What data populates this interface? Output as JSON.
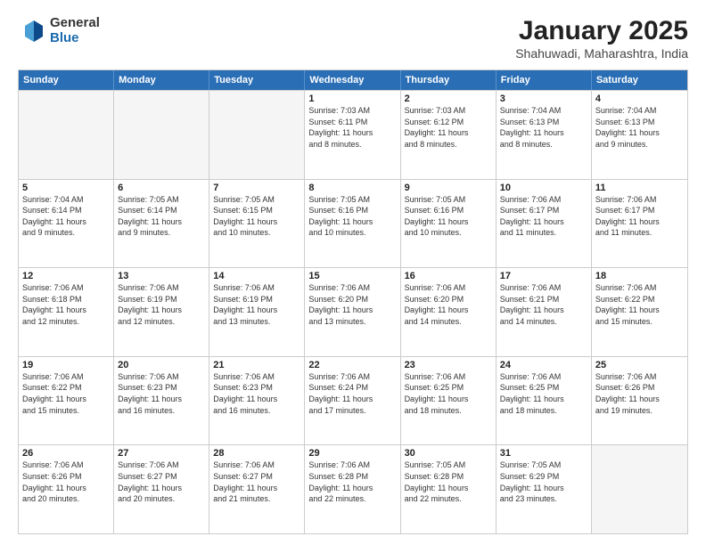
{
  "header": {
    "logo_general": "General",
    "logo_blue": "Blue",
    "title": "January 2025",
    "location": "Shahuwadi, Maharashtra, India"
  },
  "weekdays": [
    "Sunday",
    "Monday",
    "Tuesday",
    "Wednesday",
    "Thursday",
    "Friday",
    "Saturday"
  ],
  "rows": [
    [
      {
        "day": "",
        "info": ""
      },
      {
        "day": "",
        "info": ""
      },
      {
        "day": "",
        "info": ""
      },
      {
        "day": "1",
        "info": "Sunrise: 7:03 AM\nSunset: 6:11 PM\nDaylight: 11 hours\nand 8 minutes."
      },
      {
        "day": "2",
        "info": "Sunrise: 7:03 AM\nSunset: 6:12 PM\nDaylight: 11 hours\nand 8 minutes."
      },
      {
        "day": "3",
        "info": "Sunrise: 7:04 AM\nSunset: 6:13 PM\nDaylight: 11 hours\nand 8 minutes."
      },
      {
        "day": "4",
        "info": "Sunrise: 7:04 AM\nSunset: 6:13 PM\nDaylight: 11 hours\nand 9 minutes."
      }
    ],
    [
      {
        "day": "5",
        "info": "Sunrise: 7:04 AM\nSunset: 6:14 PM\nDaylight: 11 hours\nand 9 minutes."
      },
      {
        "day": "6",
        "info": "Sunrise: 7:05 AM\nSunset: 6:14 PM\nDaylight: 11 hours\nand 9 minutes."
      },
      {
        "day": "7",
        "info": "Sunrise: 7:05 AM\nSunset: 6:15 PM\nDaylight: 11 hours\nand 10 minutes."
      },
      {
        "day": "8",
        "info": "Sunrise: 7:05 AM\nSunset: 6:16 PM\nDaylight: 11 hours\nand 10 minutes."
      },
      {
        "day": "9",
        "info": "Sunrise: 7:05 AM\nSunset: 6:16 PM\nDaylight: 11 hours\nand 10 minutes."
      },
      {
        "day": "10",
        "info": "Sunrise: 7:06 AM\nSunset: 6:17 PM\nDaylight: 11 hours\nand 11 minutes."
      },
      {
        "day": "11",
        "info": "Sunrise: 7:06 AM\nSunset: 6:17 PM\nDaylight: 11 hours\nand 11 minutes."
      }
    ],
    [
      {
        "day": "12",
        "info": "Sunrise: 7:06 AM\nSunset: 6:18 PM\nDaylight: 11 hours\nand 12 minutes."
      },
      {
        "day": "13",
        "info": "Sunrise: 7:06 AM\nSunset: 6:19 PM\nDaylight: 11 hours\nand 12 minutes."
      },
      {
        "day": "14",
        "info": "Sunrise: 7:06 AM\nSunset: 6:19 PM\nDaylight: 11 hours\nand 13 minutes."
      },
      {
        "day": "15",
        "info": "Sunrise: 7:06 AM\nSunset: 6:20 PM\nDaylight: 11 hours\nand 13 minutes."
      },
      {
        "day": "16",
        "info": "Sunrise: 7:06 AM\nSunset: 6:20 PM\nDaylight: 11 hours\nand 14 minutes."
      },
      {
        "day": "17",
        "info": "Sunrise: 7:06 AM\nSunset: 6:21 PM\nDaylight: 11 hours\nand 14 minutes."
      },
      {
        "day": "18",
        "info": "Sunrise: 7:06 AM\nSunset: 6:22 PM\nDaylight: 11 hours\nand 15 minutes."
      }
    ],
    [
      {
        "day": "19",
        "info": "Sunrise: 7:06 AM\nSunset: 6:22 PM\nDaylight: 11 hours\nand 15 minutes."
      },
      {
        "day": "20",
        "info": "Sunrise: 7:06 AM\nSunset: 6:23 PM\nDaylight: 11 hours\nand 16 minutes."
      },
      {
        "day": "21",
        "info": "Sunrise: 7:06 AM\nSunset: 6:23 PM\nDaylight: 11 hours\nand 16 minutes."
      },
      {
        "day": "22",
        "info": "Sunrise: 7:06 AM\nSunset: 6:24 PM\nDaylight: 11 hours\nand 17 minutes."
      },
      {
        "day": "23",
        "info": "Sunrise: 7:06 AM\nSunset: 6:25 PM\nDaylight: 11 hours\nand 18 minutes."
      },
      {
        "day": "24",
        "info": "Sunrise: 7:06 AM\nSunset: 6:25 PM\nDaylight: 11 hours\nand 18 minutes."
      },
      {
        "day": "25",
        "info": "Sunrise: 7:06 AM\nSunset: 6:26 PM\nDaylight: 11 hours\nand 19 minutes."
      }
    ],
    [
      {
        "day": "26",
        "info": "Sunrise: 7:06 AM\nSunset: 6:26 PM\nDaylight: 11 hours\nand 20 minutes."
      },
      {
        "day": "27",
        "info": "Sunrise: 7:06 AM\nSunset: 6:27 PM\nDaylight: 11 hours\nand 20 minutes."
      },
      {
        "day": "28",
        "info": "Sunrise: 7:06 AM\nSunset: 6:27 PM\nDaylight: 11 hours\nand 21 minutes."
      },
      {
        "day": "29",
        "info": "Sunrise: 7:06 AM\nSunset: 6:28 PM\nDaylight: 11 hours\nand 22 minutes."
      },
      {
        "day": "30",
        "info": "Sunrise: 7:05 AM\nSunset: 6:28 PM\nDaylight: 11 hours\nand 22 minutes."
      },
      {
        "day": "31",
        "info": "Sunrise: 7:05 AM\nSunset: 6:29 PM\nDaylight: 11 hours\nand 23 minutes."
      },
      {
        "day": "",
        "info": ""
      }
    ]
  ]
}
